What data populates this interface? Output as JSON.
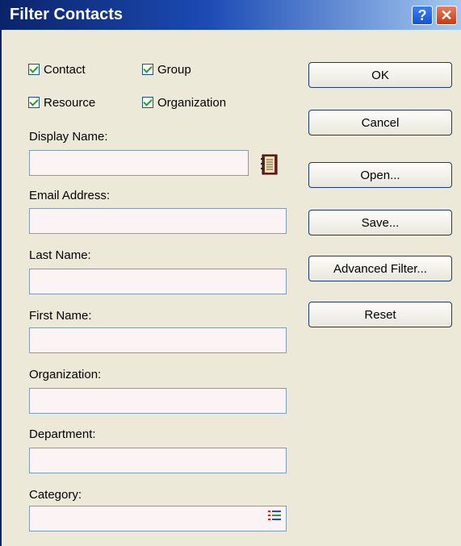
{
  "window": {
    "title": "Filter Contacts"
  },
  "titlebar": {
    "help_glyph": "?",
    "close_glyph": "✕"
  },
  "checkboxes": [
    {
      "label": "Contact",
      "checked": true
    },
    {
      "label": "Group",
      "checked": true
    },
    {
      "label": "Resource",
      "checked": true
    },
    {
      "label": "Organization",
      "checked": true
    }
  ],
  "fields": {
    "display_name": {
      "label": "Display Name:",
      "value": ""
    },
    "email_address": {
      "label": "Email Address:",
      "value": ""
    },
    "last_name": {
      "label": "Last Name:",
      "value": ""
    },
    "first_name": {
      "label": "First Name:",
      "value": ""
    },
    "organization": {
      "label": "Organization:",
      "value": ""
    },
    "department": {
      "label": "Department:",
      "value": ""
    },
    "category": {
      "label": "Category:",
      "value": ""
    }
  },
  "buttons": {
    "ok": "OK",
    "cancel": "Cancel",
    "open": "Open...",
    "save": "Save...",
    "advanced_filter": "Advanced Filter...",
    "reset": "Reset"
  },
  "icons": {
    "address_book": "address-book-icon",
    "category_list": "list-icon"
  },
  "colors": {
    "title_gradient_start": "#0a246a",
    "title_gradient_end": "#a6caf0",
    "field_background": "#fcf4f4",
    "dialog_background": "#ece9d8",
    "checkmark": "#21a121"
  }
}
